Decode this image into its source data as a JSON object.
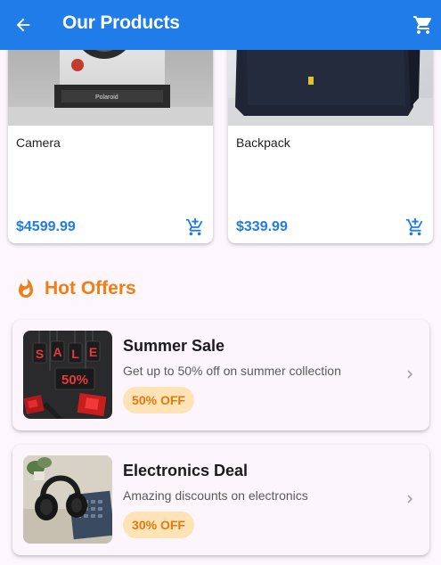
{
  "appbar": {
    "title": "Our Products",
    "back_icon": "arrow-back-icon",
    "cart_icon": "shopping-cart-icon",
    "color": "#1f7ce8"
  },
  "products": [
    {
      "name": "Camera",
      "price": "$4599.99",
      "image": "instant-camera-photo",
      "action_icon": "add-shopping-cart-icon"
    },
    {
      "name": "Backpack",
      "price": "$339.99",
      "image": "black-backpack-photo",
      "action_icon": "add-shopping-cart-icon"
    }
  ],
  "camera_image_text": {
    "brand": "Polaroid"
  },
  "hot_offers": {
    "heading": "Hot Offers",
    "icon": "fire-icon",
    "accent": "#f07e12",
    "items": [
      {
        "title": "Summer Sale",
        "description": "Get up to 50% off on summer collection",
        "badge": "50% OFF",
        "image": "sale-tags-photo",
        "image_text": {
          "letters": [
            "S",
            "A",
            "L",
            "E"
          ],
          "percent": "50%"
        }
      },
      {
        "title": "Electronics Deal",
        "description": "Amazing discounts on electronics",
        "badge": "30% OFF",
        "image": "headphones-desk-photo"
      }
    ]
  }
}
